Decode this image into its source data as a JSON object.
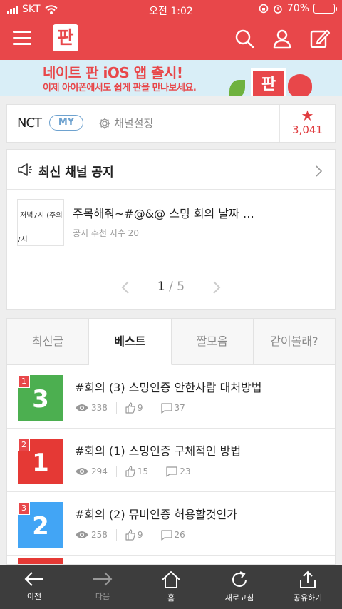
{
  "status_bar": {
    "carrier": "SKT",
    "time": "오전 1:02",
    "battery": "70%",
    "battery_level": 0.7
  },
  "header": {
    "logo_text": "판"
  },
  "banner": {
    "title": "네이트 판 iOS 앱 출시!",
    "subtitle": "이제 아이폰에서도 쉽게 판을 만나보세요.",
    "logo_text": "판"
  },
  "channel": {
    "name": "NCT",
    "badge": "MY",
    "settings_label": "채널설정",
    "favorite_count": "3,041"
  },
  "notice": {
    "title": "최신 채널 공지",
    "item": {
      "thumb_line1": ") 저녁7시 (주의",
      "thumb_line2": "7시",
      "title": "주목해줘~#@&@ 스밍 회의 날짜 …",
      "meta": "공지 추천 지수 20"
    },
    "pager": {
      "current": "1",
      "total": " / 5"
    }
  },
  "tabs": [
    {
      "label": "최신글",
      "active": false
    },
    {
      "label": "베스트",
      "active": true
    },
    {
      "label": "짤모음",
      "active": false
    },
    {
      "label": "같이볼래?",
      "active": false
    }
  ],
  "posts": [
    {
      "rank": "1",
      "tile_number": "3",
      "tile_color": "#4caf50",
      "title": "#회의 (3) 스밍인증 안한사람 대처방법",
      "views": "338",
      "likes": "9",
      "comments": "37"
    },
    {
      "rank": "2",
      "tile_number": "1",
      "tile_color": "#e53935",
      "title": "#회의 (1) 스밍인증 구체적인 방법",
      "views": "294",
      "likes": "15",
      "comments": "23"
    },
    {
      "rank": "3",
      "tile_number": "2",
      "tile_color": "#42a5f5",
      "title": "#회의 (2) 뮤비인증 허용할것인가",
      "views": "258",
      "likes": "9",
      "comments": "26"
    }
  ],
  "toolbar": {
    "back": "이전",
    "forward": "다음",
    "home": "홈",
    "refresh": "새로고침",
    "share": "공유하기"
  },
  "colors": {
    "brand": "#e8474a",
    "badge_blue": "#6ea2cf",
    "toolbar_bg": "#3d3d3d"
  }
}
